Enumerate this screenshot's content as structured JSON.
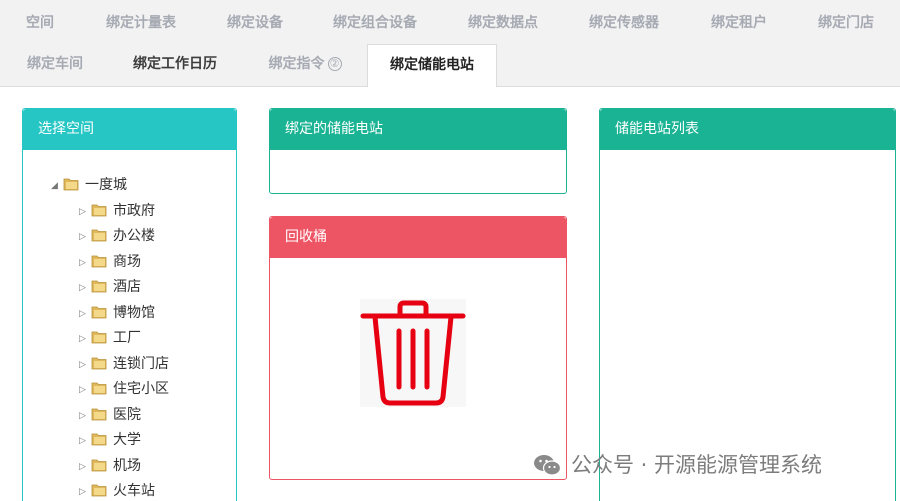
{
  "tabs": {
    "row1": [
      "空间",
      "绑定计量表",
      "绑定设备",
      "绑定组合设备",
      "绑定数据点",
      "绑定传感器",
      "绑定租户",
      "绑定门店"
    ],
    "row2": [
      "绑定车间",
      "绑定工作日历",
      "绑定指令",
      "绑定储能电站"
    ],
    "row2_badge": "②",
    "active": "绑定储能电站"
  },
  "space_panel": {
    "title": "选择空间",
    "root": "一度城",
    "children": [
      "市政府",
      "办公楼",
      "商场",
      "酒店",
      "博物馆",
      "工厂",
      "连锁门店",
      "住宅小区",
      "医院",
      "大学",
      "机场",
      "火车站"
    ]
  },
  "bound_panel": {
    "title": "绑定的储能电站"
  },
  "recycle_panel": {
    "title": "回收桶",
    "icon": "trash-icon"
  },
  "list_panel": {
    "title": "储能电站列表"
  },
  "watermark": {
    "text": "公众号 · 开源能源管理系统",
    "icon": "wechat-icon"
  },
  "colors": {
    "teal": "#25c6c4",
    "green": "#1ab394",
    "red": "#ed5565",
    "trash_red": "#e60012",
    "folder": "#e0b85c"
  }
}
